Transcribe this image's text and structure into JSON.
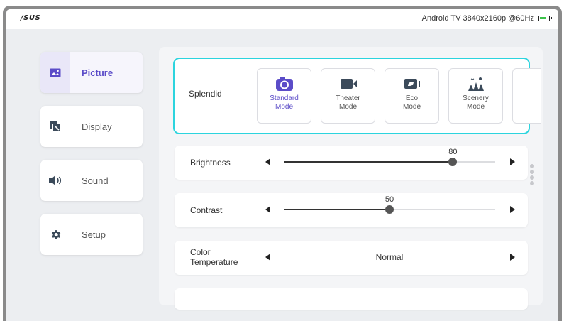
{
  "topbar": {
    "logo": "/SUS",
    "status": "Android TV  3840x2160p @60Hz"
  },
  "menu": [
    {
      "label": "Picture",
      "icon": "picture-icon"
    },
    {
      "label": "Display",
      "icon": "display-icon"
    },
    {
      "label": "Sound",
      "icon": "speaker-icon"
    },
    {
      "label": "Setup",
      "icon": "gear-icon"
    }
  ],
  "splendid": {
    "label": "Splendid",
    "modes": [
      {
        "line1": "Standard",
        "line2": "Mode",
        "icon": "camera-icon"
      },
      {
        "line1": "Theater",
        "line2": "Mode",
        "icon": "video-camera-icon"
      },
      {
        "line1": "Eco",
        "line2": "Mode",
        "icon": "eco-leaf-icon"
      },
      {
        "line1": "Scenery",
        "line2": "Mode",
        "icon": "trees-icon"
      }
    ]
  },
  "settings": {
    "brightness": {
      "label": "Brightness",
      "value": "80",
      "fraction": 0.8
    },
    "contrast": {
      "label": "Contrast",
      "value": "50",
      "fraction": 0.5
    },
    "color_temperature": {
      "label_line1": "Color",
      "label_line2": "Temperature",
      "value": "Normal"
    }
  },
  "colors": {
    "accent": "#5b4cc8",
    "highlight": "#2cd4de",
    "battery": "#3cc24a"
  }
}
